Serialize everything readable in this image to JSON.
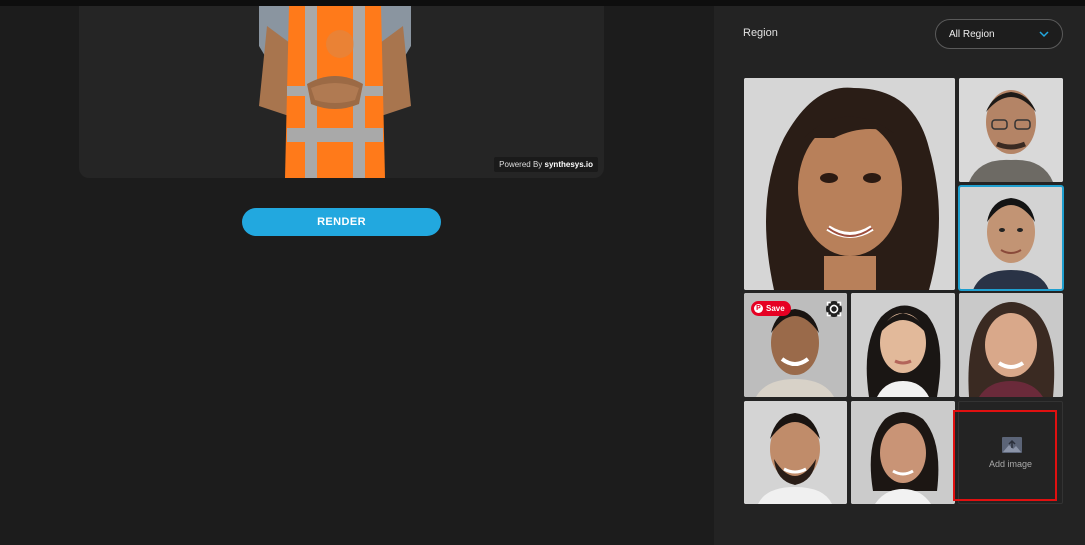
{
  "preview": {
    "watermark_prefix": "Powered By",
    "watermark_brand": "synthesys.io"
  },
  "actions": {
    "render_label": "RENDER"
  },
  "region": {
    "label": "Region",
    "selected": "All Region"
  },
  "gallery": {
    "save_label": "Save",
    "add_image_label": "Add image",
    "avatars": [
      {
        "name": "avatar-woman-curly-hair"
      },
      {
        "name": "avatar-man-glasses"
      },
      {
        "name": "avatar-man-short-hair"
      },
      {
        "name": "avatar-man-smiling"
      },
      {
        "name": "avatar-woman-asian"
      },
      {
        "name": "avatar-woman-brown-hair"
      },
      {
        "name": "avatar-man-beard"
      },
      {
        "name": "avatar-woman-ponytail"
      }
    ]
  },
  "colors": {
    "accent": "#22a8df",
    "highlight": "#e01010",
    "pinterest": "#e60023"
  }
}
